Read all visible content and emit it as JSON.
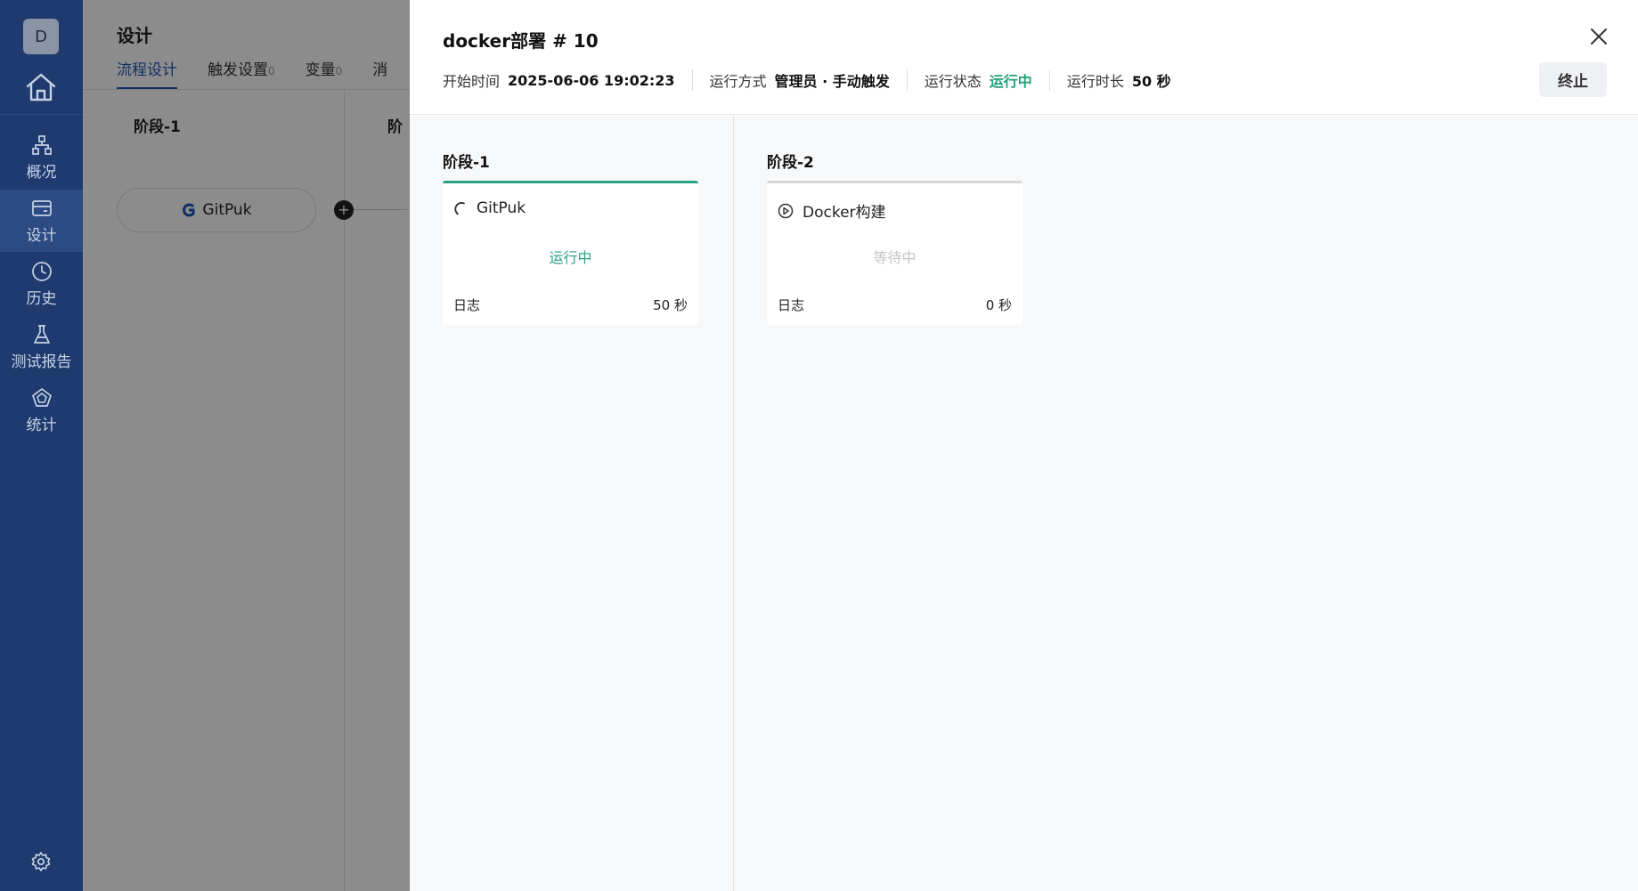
{
  "sidebar": {
    "avatar": "D",
    "items": [
      {
        "label": "概况",
        "icon": "org-chart-icon"
      },
      {
        "label": "设计",
        "icon": "card-icon"
      },
      {
        "label": "历史",
        "icon": "clock-icon"
      },
      {
        "label": "测试报告",
        "icon": "flask-icon"
      },
      {
        "label": "统计",
        "icon": "pentagon-chart-icon"
      }
    ],
    "active": "设计"
  },
  "background": {
    "title": "设计",
    "tabs": [
      {
        "label": "流程设计",
        "count": ""
      },
      {
        "label": "触发设置",
        "count": "0"
      },
      {
        "label": "变量",
        "count": "0"
      },
      {
        "label": "消",
        "count": ""
      }
    ],
    "stage1": "阶段-1",
    "stage2": "阶",
    "node_label": "GitPuk"
  },
  "drawer": {
    "title": "docker部署 # 10",
    "meta": {
      "start_key": "开始时间",
      "start_value": "2025-06-06 19:02:23",
      "mode_key": "运行方式",
      "mode_value": "管理员 · 手动触发",
      "status_key": "运行状态",
      "status_value": "运行中",
      "duration_key": "运行时长",
      "duration_value": "50 秒"
    },
    "stop_label": "终止",
    "stages": [
      {
        "title": "阶段-1",
        "task": "GitPuk",
        "status": "运行中",
        "log_label": "日志",
        "time": "50 秒"
      },
      {
        "title": "阶段-2",
        "task": "Docker构建",
        "status": "等待中",
        "log_label": "日志",
        "time": "0 秒"
      }
    ]
  },
  "colors": {
    "sidebar_bg": "#1e3a6e",
    "accent_blue": "#1e52b8",
    "running_green": "#2aa084"
  }
}
